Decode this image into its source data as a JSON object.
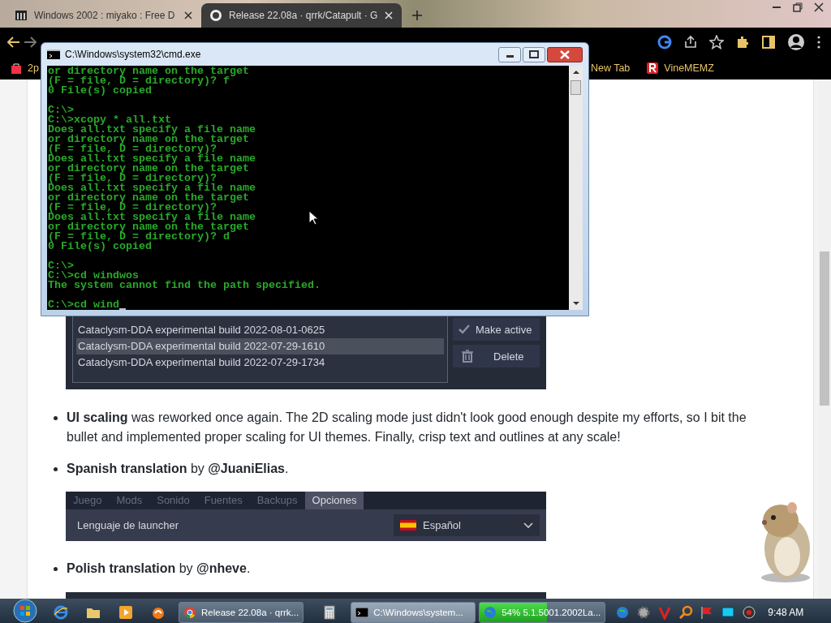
{
  "browser": {
    "tabs": [
      {
        "title": "Windows 2002 : miyako : Free D",
        "selected": false
      },
      {
        "title": "Release 22.08a · qrrk/Catapult · G",
        "selected": true
      }
    ],
    "bookmarks": [
      {
        "label": "2p"
      },
      {
        "label": "New Tab"
      },
      {
        "label": "VineMEMZ"
      }
    ]
  },
  "page": {
    "builds": [
      {
        "label": "Cataclysm-DDA experimental build 2022-08-01-0625",
        "selected": false
      },
      {
        "label": "Cataclysm-DDA experimental build 2022-07-29-1610",
        "selected": true
      },
      {
        "label": "Cataclysm-DDA experimental build 2022-07-29-1734",
        "selected": false
      }
    ],
    "build_buttons": [
      {
        "label": "Make active",
        "kind": "check"
      },
      {
        "label": "Delete",
        "kind": "trash"
      }
    ],
    "bullets": [
      {
        "text": "**UI scaling** was reworked once again. The 2D scaling mode just didn't look good enough despite my efforts, so I bit the bullet and implemented proper scaling for UI themes. Finally, crisp text and outlines at any scale!"
      },
      {
        "text": "**Spanish translation** by ",
        "link": "@JuaniElias",
        "after": "."
      },
      {
        "text": "**Polish translation** by ",
        "link": "@nheve",
        "after": "."
      }
    ],
    "language_panel": {
      "tabs": [
        {
          "label": "Juego",
          "selected": false
        },
        {
          "label": "Mods",
          "selected": false
        },
        {
          "label": "Sonido",
          "selected": false
        },
        {
          "label": "Fuentes",
          "selected": false
        },
        {
          "label": "Backups",
          "selected": false
        },
        {
          "label": "Opciones",
          "selected": true
        }
      ],
      "setting_label": "Lenguaje de launcher",
      "dropdown_value": "Español"
    }
  },
  "console": {
    "title": "C:\\Windows\\system32\\cmd.exe",
    "blocks": [
      [
        "or directory name on the target",
        "(F = file, D = directory)? f",
        "0 File(s) copied"
      ],
      [
        "C:\\>",
        "C:\\>xcopy * all.txt",
        "Does all.txt specify a file name",
        "or directory name on the target",
        "(F = file, D = directory)?",
        "Does all.txt specify a file name",
        "or directory name on the target",
        "(F = file, D = directory)?",
        "Does all.txt specify a file name",
        "or directory name on the target",
        "(F = file, D = directory)?",
        "Does all.txt specify a file name",
        "or directory name on the target",
        "(F = file, D = directory)? d",
        "0 File(s) copied"
      ],
      [
        "C:\\>",
        "C:\\>cd windwos",
        "The system cannot find the path specified."
      ]
    ],
    "input": "C:\\>cd wind"
  },
  "taskbar": {
    "tasks": [
      {
        "kind": "window",
        "label": "Release 22.08a · qrrk...",
        "selected": false
      },
      {
        "kind": "window",
        "label": "C:\\Windows\\system...",
        "selected": true
      },
      {
        "kind": "progress",
        "label": "54% 5.1.5001.2002La...",
        "selected": false,
        "level": 0.54
      }
    ],
    "clock": "9:48 AM"
  }
}
